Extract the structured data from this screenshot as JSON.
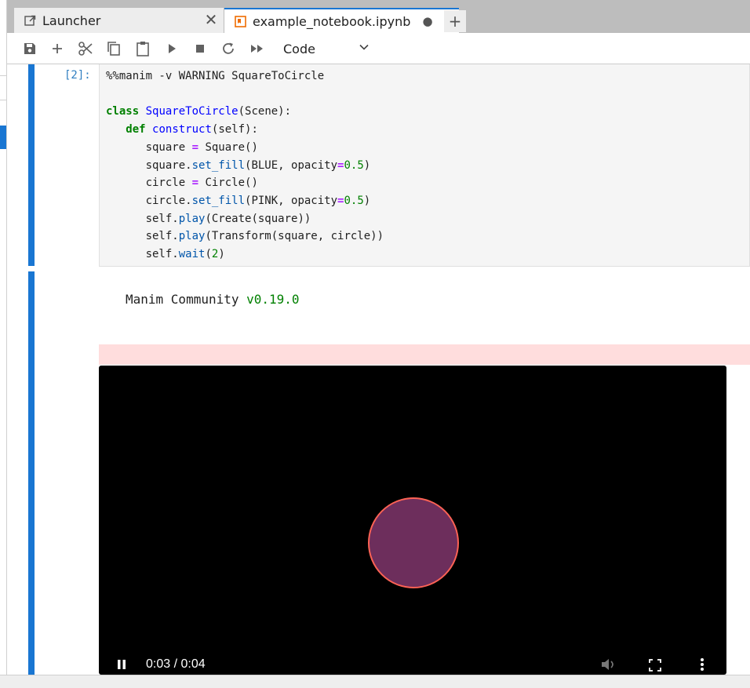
{
  "tabs": [
    {
      "label": "Launcher",
      "icon": "launcher-icon",
      "close": "✕"
    },
    {
      "label": "example_notebook.ipynb",
      "icon": "notebook-icon",
      "close": "●"
    }
  ],
  "tab_add": "+",
  "toolbar": {
    "buttons": [
      "save-icon",
      "add-cell-icon",
      "cut-icon",
      "copy-icon",
      "paste-icon",
      "run-icon",
      "stop-icon",
      "restart-icon",
      "run-all-icon"
    ],
    "cell_type": "Code"
  },
  "cell": {
    "prompt": "[2]:",
    "magic_line": "%%manim -v WARNING SquareToCircle"
  },
  "output": {
    "prefix": "Manim Community ",
    "version": "v0.19.0"
  },
  "video": {
    "time": "0:03 / 0:04"
  },
  "colors": {
    "accent": "#1976d2",
    "circle_fill": "#6d2e5c",
    "circle_stroke": "#fc6255",
    "stderr_bg": "#ffdddd"
  }
}
